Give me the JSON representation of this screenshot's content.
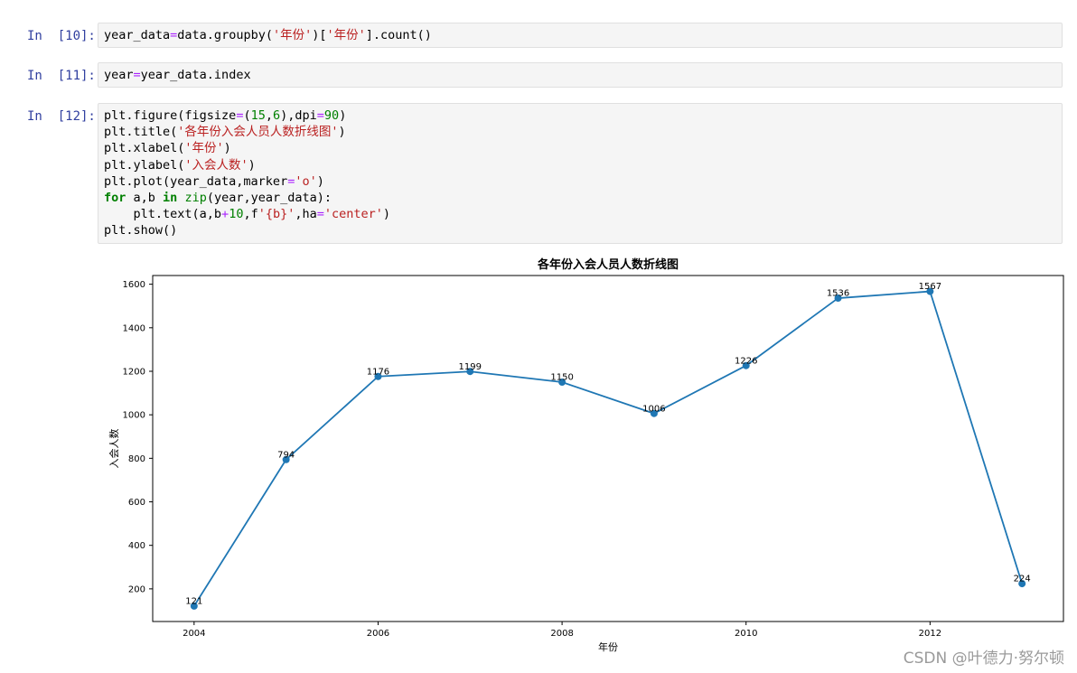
{
  "cells": [
    {
      "prompt": "In  [10]:",
      "lines": [
        [
          [
            "plain",
            "year_data"
          ],
          [
            "op",
            "="
          ],
          [
            "plain",
            "data.groupby("
          ],
          [
            "str",
            "'年份'"
          ],
          [
            "plain",
            ")["
          ],
          [
            "str",
            "'年份'"
          ],
          [
            "plain",
            "].count()"
          ]
        ]
      ]
    },
    {
      "prompt": "In  [11]:",
      "lines": [
        [
          [
            "plain",
            "year"
          ],
          [
            "op",
            "="
          ],
          [
            "plain",
            "year_data.index"
          ]
        ]
      ]
    },
    {
      "prompt": "In  [12]:",
      "lines": [
        [
          [
            "plain",
            "plt.figure(figsize"
          ],
          [
            "op",
            "="
          ],
          [
            "plain",
            "("
          ],
          [
            "num",
            "15"
          ],
          [
            "plain",
            ","
          ],
          [
            "num",
            "6"
          ],
          [
            "plain",
            "),dpi"
          ],
          [
            "op",
            "="
          ],
          [
            "num",
            "90"
          ],
          [
            "plain",
            ")"
          ]
        ],
        [
          [
            "plain",
            "plt.title("
          ],
          [
            "str",
            "'各年份入会人员人数折线图'"
          ],
          [
            "plain",
            ")"
          ]
        ],
        [
          [
            "plain",
            "plt.xlabel("
          ],
          [
            "str",
            "'年份'"
          ],
          [
            "plain",
            ")"
          ]
        ],
        [
          [
            "plain",
            "plt.ylabel("
          ],
          [
            "str",
            "'入会人数'"
          ],
          [
            "plain",
            ")"
          ]
        ],
        [
          [
            "plain",
            "plt.plot(year_data,marker"
          ],
          [
            "op",
            "="
          ],
          [
            "str",
            "'o'"
          ],
          [
            "plain",
            ")"
          ]
        ],
        [
          [
            "kw",
            "for"
          ],
          [
            "plain",
            " a,b "
          ],
          [
            "kw",
            "in"
          ],
          [
            "plain",
            " "
          ],
          [
            "num",
            "zip"
          ],
          [
            "plain",
            "(year,year_data):"
          ]
        ],
        [
          [
            "plain",
            "    plt.text(a,b"
          ],
          [
            "op",
            "+"
          ],
          [
            "num",
            "10"
          ],
          [
            "plain",
            ",f"
          ],
          [
            "str",
            "'{b}'"
          ],
          [
            "plain",
            ",ha"
          ],
          [
            "op",
            "="
          ],
          [
            "str",
            "'center'"
          ],
          [
            "plain",
            ")"
          ]
        ],
        [
          [
            "plain",
            "plt.show()"
          ]
        ]
      ]
    }
  ],
  "chart_data": {
    "type": "line",
    "title": "各年份入会人员人数折线图",
    "xlabel": "年份",
    "ylabel": "入会人数",
    "x": [
      2004,
      2005,
      2006,
      2007,
      2008,
      2009,
      2010,
      2011,
      2012,
      2013
    ],
    "values": [
      121,
      794,
      1176,
      1199,
      1150,
      1006,
      1226,
      1536,
      1567,
      224
    ],
    "xticks": [
      2004,
      2006,
      2008,
      2010,
      2012
    ],
    "yticks": [
      200,
      400,
      600,
      800,
      1000,
      1200,
      1400,
      1600
    ],
    "xlim": [
      2003.55,
      2013.45
    ],
    "ylim": [
      50,
      1640
    ],
    "grid": false,
    "marker": "o",
    "color": "#1f77b4"
  },
  "watermark": "CSDN @叶德力·努尔顿"
}
